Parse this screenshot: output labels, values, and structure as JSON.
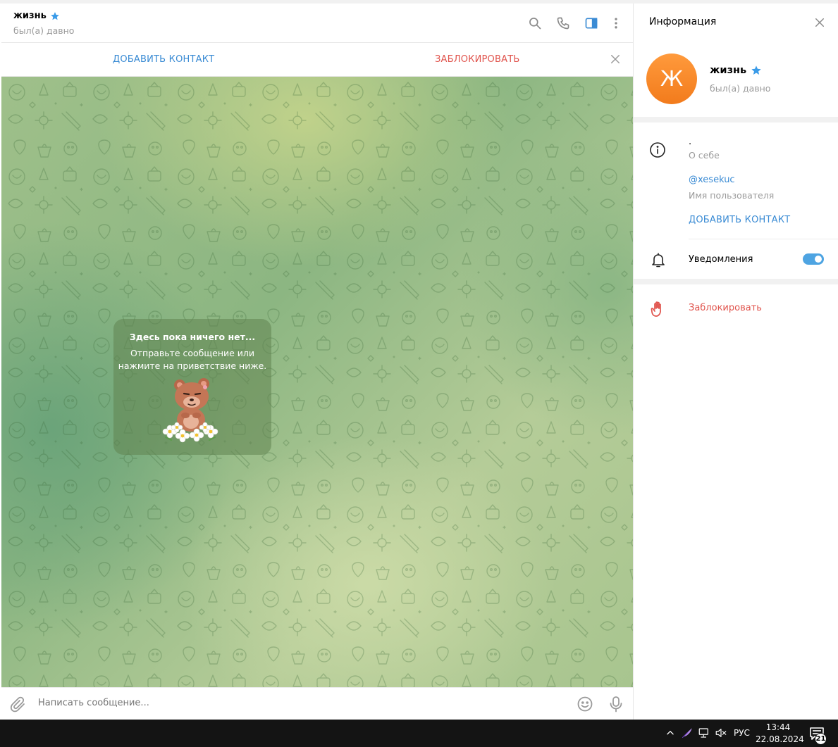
{
  "chat": {
    "title": "жизнь",
    "status": "был(а) давно",
    "header_icons": [
      "search-icon",
      "phone-icon",
      "sidebar-toggle-icon",
      "more-vertical-icon"
    ],
    "action_bar": {
      "add_contact": "ДОБАВИТЬ КОНТАКТ",
      "block": "ЗАБЛОКИРОВАТЬ"
    },
    "empty_state": {
      "title": "Здесь пока ничего нет...",
      "line1": "Отправьте сообщение или",
      "line2": "нажмите на приветствие ниже."
    },
    "composer": {
      "placeholder": "Написать сообщение..."
    }
  },
  "info_panel": {
    "title": "Информация",
    "avatar_letter": "Ж",
    "name": "жизнь",
    "status": "был(а) давно",
    "about_value": ".",
    "about_label": "О себе",
    "username_value": "@xesekuc",
    "username_label": "Имя пользователя",
    "add_contact": "ДОБАВИТЬ КОНТАКТ",
    "notifications_label": "Уведомления",
    "notifications_on": true,
    "block": "Заблокировать"
  },
  "taskbar": {
    "language": "РУС",
    "time": "13:44",
    "date": "22.08.2024",
    "notification_count": "21"
  },
  "colors": {
    "accent": "#3a8bd4",
    "danger": "#e0534c",
    "avatar": "#f58a2a",
    "toggle": "#4ea4e2",
    "verified_star": "#3a9be8"
  }
}
